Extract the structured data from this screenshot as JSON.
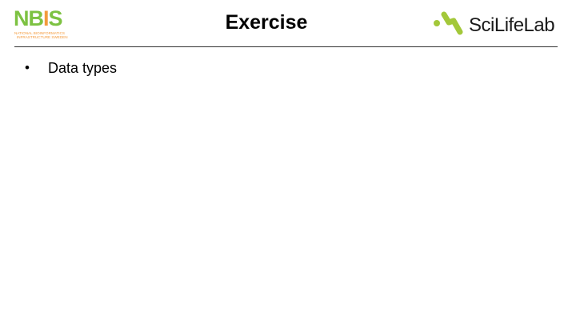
{
  "header": {
    "title": "Exercise",
    "left_logo": {
      "text": "NBIS",
      "subtitle_line1": "NATIONAL BIOINFORMATICS",
      "subtitle_line2": "INFRASTRUCTURE SWEDEN",
      "color": "#7dc242",
      "accent": "#f39a3c"
    },
    "right_logo": {
      "text": "SciLifeLab",
      "icon_color": "#a3c83a"
    }
  },
  "body": {
    "bullets": [
      {
        "symbol": "•",
        "text": "Data types"
      }
    ]
  }
}
